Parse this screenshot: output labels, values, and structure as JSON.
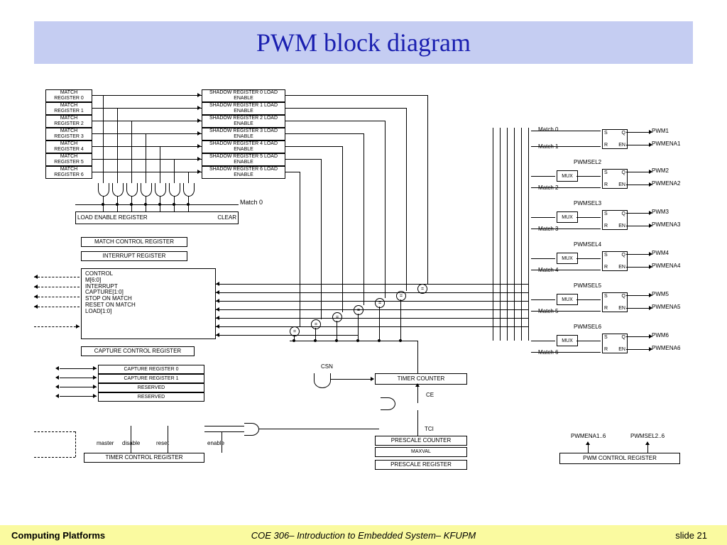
{
  "title": "PWM block diagram",
  "footer": {
    "left": "Computing Platforms",
    "center": "COE 306– Introduction to Embedded System– KFUPM",
    "right": "slide 21"
  },
  "left_regs": [
    "MATCH REGISTER 0",
    "MATCH REGISTER 1",
    "MATCH REGISTER 2",
    "MATCH REGISTER 3",
    "MATCH REGISTER 4",
    "MATCH REGISTER 5",
    "MATCH REGISTER 6"
  ],
  "shadow_regs": [
    "SHADOW REGISTER 0 LOAD ENABLE",
    "SHADOW REGISTER 1 LOAD ENABLE",
    "SHADOW REGISTER 2 LOAD ENABLE",
    "SHADOW REGISTER 3 LOAD ENABLE",
    "SHADOW REGISTER 4 LOAD ENABLE",
    "SHADOW REGISTER 5 LOAD ENABLE",
    "SHADOW REGISTER 6 LOAD ENABLE"
  ],
  "load_enable": {
    "label": "LOAD ENABLE REGISTER",
    "clear": "CLEAR"
  },
  "mcr": "MATCH CONTROL REGISTER",
  "ir": "INTERRUPT REGISTER",
  "ctrl_lines": [
    "CONTROL",
    "M[6:0]",
    "INTERRUPT",
    "CAPTURE[1:0]",
    "STOP ON MATCH",
    "RESET ON MATCH",
    "LOAD[1:0]"
  ],
  "ccr": "CAPTURE CONTROL REGISTER",
  "cap_regs": [
    "CAPTURE REGISTER 0",
    "CAPTURE REGISTER 1",
    "RESERVED",
    "RESERVED"
  ],
  "tcr": "TIMER CONTROL REGISTER",
  "tcr_sigs": {
    "master": "master",
    "disable": "disable",
    "reset": "reset",
    "enable": "enable"
  },
  "tc": "TIMER COUNTER",
  "pc": "PRESCALE COUNTER",
  "pr": "PRESCALE REGISTER",
  "maxval": "MAXVAL",
  "csn": "CSN",
  "ce": "CE",
  "tci": "TCI",
  "matches": [
    "Match 0",
    "Match 1",
    "Match 2",
    "Match 3",
    "Match 4",
    "Match 5",
    "Match 6"
  ],
  "pwmsel": [
    "PWMSEL2",
    "PWMSEL3",
    "PWMSEL4",
    "PWMSEL5",
    "PWMSEL6"
  ],
  "pwm_out": [
    "PWM1",
    "PWMENA1",
    "PWM2",
    "PWMENA2",
    "PWM3",
    "PWMENA3",
    "PWM4",
    "PWMENA4",
    "PWM5",
    "PWMENA5",
    "PWM6",
    "PWMENA6"
  ],
  "mux": "MUX",
  "pcr": "PWM CONTROL REGISTER",
  "pcr_in": {
    "a": "PWMENA1..6",
    "b": "PWMSEL2..6"
  },
  "match0_lbl": "Match 0"
}
